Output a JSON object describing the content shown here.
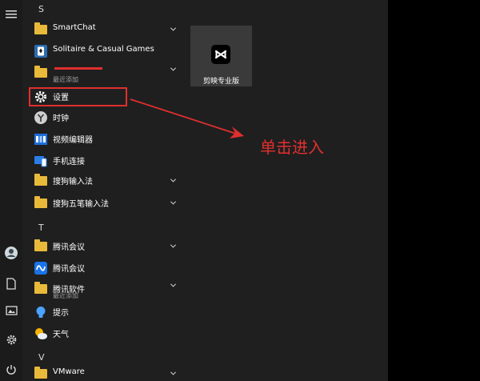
{
  "start_menu": {
    "sections": [
      {
        "header": "S",
        "items": [
          {
            "label": "SmartChat",
            "icon": "folder-icon",
            "expandable": true
          },
          {
            "label": "Solitaire & Casual Games",
            "icon": "cards-icon",
            "expandable": false
          },
          {
            "label": "",
            "sublabel": "最近添加",
            "icon": "folder-icon",
            "expandable": true
          },
          {
            "label": "设置",
            "icon": "gear-icon",
            "expandable": false
          },
          {
            "label": "时钟",
            "icon": "clock-icon",
            "expandable": false
          },
          {
            "label": "视频编辑器",
            "icon": "video-editor-icon",
            "expandable": false
          },
          {
            "label": "手机连接",
            "icon": "phone-link-icon",
            "expandable": false
          },
          {
            "label": "搜狗输入法",
            "icon": "folder-icon",
            "expandable": true
          },
          {
            "label": "搜狗五笔输入法",
            "icon": "folder-icon",
            "expandable": true
          }
        ]
      },
      {
        "header": "T",
        "items": [
          {
            "label": "腾讯会议",
            "icon": "folder-icon",
            "expandable": true
          },
          {
            "label": "腾讯会议",
            "icon": "tencent-meeting-icon",
            "expandable": false
          },
          {
            "label": "腾讯软件",
            "sublabel": "最近添加",
            "icon": "folder-icon",
            "expandable": true
          },
          {
            "label": "提示",
            "icon": "tips-icon",
            "expandable": false
          },
          {
            "label": "天气",
            "icon": "weather-icon",
            "expandable": false
          }
        ]
      },
      {
        "header": "V",
        "items": [
          {
            "label": "VMware",
            "icon": "folder-icon",
            "expandable": true
          }
        ]
      }
    ]
  },
  "pinned_tile": {
    "label": "剪映专业版",
    "icon": "capcut-icon"
  },
  "annotation": {
    "text": "单击进入",
    "color": "#e02f2f"
  },
  "colors": {
    "menu_background": "#1f1f1f",
    "tile_background": "#3a3a3a",
    "folder": "#e9b93a",
    "annotation_red": "#e02f2f"
  }
}
